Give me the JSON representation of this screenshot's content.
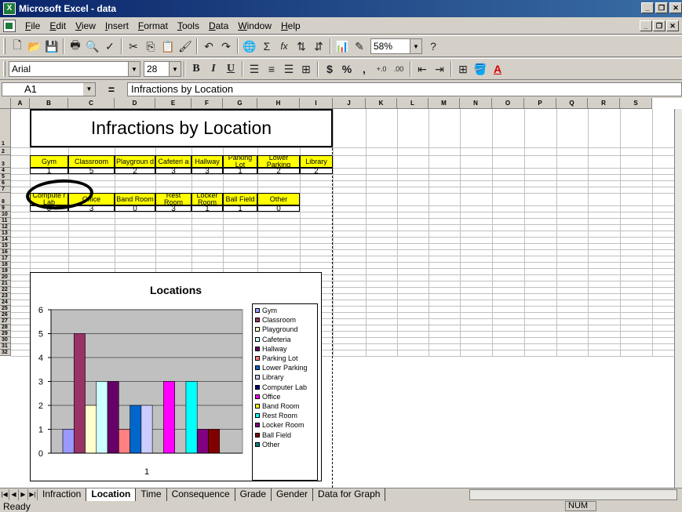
{
  "window": {
    "title": "Microsoft Excel - data",
    "app_icon": "excel-icon"
  },
  "menu": [
    "File",
    "Edit",
    "View",
    "Insert",
    "Format",
    "Tools",
    "Data",
    "Window",
    "Help"
  ],
  "toolbar1": {
    "icons": [
      "new-icon",
      "open-icon",
      "save-icon",
      "print-icon",
      "print-preview-icon",
      "spelling-icon",
      "cut-icon",
      "copy-icon",
      "paste-icon",
      "format-painter-icon",
      "undo-icon",
      "redo-icon",
      "hyperlink-icon",
      "autosum-icon",
      "function-icon",
      "sort-ascending-icon",
      "sort-descending-icon",
      "chart-wizard-icon",
      "drawing-icon",
      "help-icon"
    ],
    "glyphs": {
      "autosum": "Σ",
      "function": "fx"
    },
    "zoom": "58%"
  },
  "toolbar2": {
    "font": "Arial",
    "size": "28",
    "bold": "B",
    "italic": "I",
    "underline": "U",
    "currency": "$",
    "percent": "%",
    "comma": ",",
    "inc_decimal": "+.0",
    "dec_decimal": ".00"
  },
  "formula": {
    "name_box": "A1",
    "equals": "=",
    "content": "Infractions by Location"
  },
  "columns": [
    "A",
    "B",
    "C",
    "D",
    "E",
    "F",
    "G",
    "H",
    "I",
    "J",
    "K",
    "L",
    "M",
    "N",
    "O",
    "P",
    "Q",
    "R",
    "S"
  ],
  "rows": [
    "1",
    "2",
    "3",
    "4",
    "5",
    "6",
    "7",
    "8",
    "9",
    "10",
    "11",
    "12",
    "13",
    "14",
    "15",
    "16",
    "17",
    "18",
    "19",
    "20",
    "21",
    "22",
    "23",
    "24",
    "25",
    "26",
    "27",
    "28",
    "29",
    "30",
    "31",
    "32"
  ],
  "sheet": {
    "title": "Infractions by Location",
    "table1": {
      "headers": [
        "Gym",
        "Classroom",
        "Playgroun d",
        "Cafeteri a",
        "Hallway",
        "Parking Lot",
        "Lower Parking",
        "Library"
      ],
      "values": [
        "1",
        "5",
        "2",
        "3",
        "3",
        "1",
        "2",
        "2"
      ]
    },
    "table2": {
      "headers": [
        "Compute r Lab",
        "Office",
        "Band Room",
        "Rest Room",
        "Locker Room",
        "Ball Field",
        "Other"
      ],
      "values": [
        "0",
        "3",
        "0",
        "3",
        "1",
        "1",
        "0"
      ]
    }
  },
  "chart_data": {
    "type": "bar",
    "title": "Locations",
    "categories": [
      "1"
    ],
    "ylim": [
      0,
      6
    ],
    "yticks": [
      "0",
      "1",
      "2",
      "3",
      "4",
      "5",
      "6"
    ],
    "xlabel": "",
    "ylabel": "",
    "legend_position": "right",
    "series": [
      {
        "name": "Gym",
        "values": [
          1
        ],
        "color": "#9999ff"
      },
      {
        "name": "Classroom",
        "values": [
          5
        ],
        "color": "#993366"
      },
      {
        "name": "Playground",
        "values": [
          2
        ],
        "color": "#ffffcc"
      },
      {
        "name": "Cafeteria",
        "values": [
          3
        ],
        "color": "#ccffff"
      },
      {
        "name": "Hallway",
        "values": [
          3
        ],
        "color": "#660066"
      },
      {
        "name": "Parking Lot",
        "values": [
          1
        ],
        "color": "#ff8080"
      },
      {
        "name": "Lower Parking",
        "values": [
          2
        ],
        "color": "#0066cc"
      },
      {
        "name": "Library",
        "values": [
          2
        ],
        "color": "#ccccff"
      },
      {
        "name": "Computer Lab",
        "values": [
          0
        ],
        "color": "#000080"
      },
      {
        "name": "Office",
        "values": [
          3
        ],
        "color": "#ff00ff"
      },
      {
        "name": "Band Room",
        "values": [
          0
        ],
        "color": "#ffff00"
      },
      {
        "name": "Rest Room",
        "values": [
          3
        ],
        "color": "#00ffff"
      },
      {
        "name": "Locker Room",
        "values": [
          1
        ],
        "color": "#800080"
      },
      {
        "name": "Ball Field",
        "values": [
          1
        ],
        "color": "#800000"
      },
      {
        "name": "Other",
        "values": [
          0
        ],
        "color": "#008080"
      }
    ],
    "plot_area_color": "#c0c0c0"
  },
  "tabs": [
    "Infraction",
    "Location",
    "Time",
    "Consequence",
    "Grade",
    "Gender",
    "Data for Graph"
  ],
  "active_tab": "Location",
  "status": {
    "text": "Ready",
    "num": "NUM"
  }
}
